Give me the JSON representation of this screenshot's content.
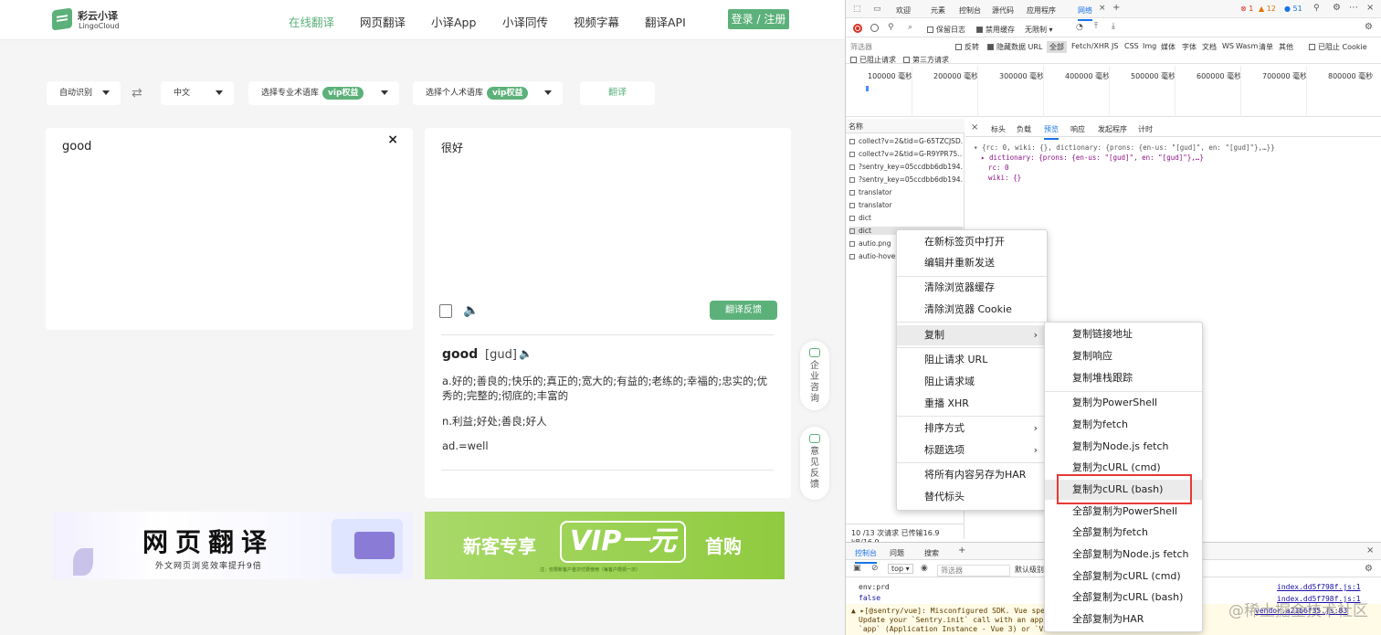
{
  "site": {
    "logo_cn": "彩云小译",
    "logo_en": "LingoCloud",
    "nav": [
      "在线翻译",
      "网页翻译",
      "小译App",
      "小译同传",
      "视频字幕",
      "翻译API"
    ],
    "login": "登录 / 注册"
  },
  "controls": {
    "source_lang": "自动识别",
    "target_lang": "中文",
    "pro_glossary": "选择专业术语库",
    "personal_glossary": "选择个人术语库",
    "vip": "vip权益",
    "translate": "翻译"
  },
  "input": {
    "text": "good"
  },
  "output": {
    "text": "很好",
    "feedback": "翻译反馈",
    "word": "good",
    "phonetic": "[gud]",
    "defs": [
      "a.好的;善良的;快乐的;真正的;宽大的;有益的;老练的;幸福的;忠实的;优秀的;完整的;彻底的;丰富的",
      "n.利益;好处;善良;好人",
      "ad.=well"
    ]
  },
  "side": {
    "consult": "企业咨询",
    "opinion": "意见反馈"
  },
  "banners": {
    "b1_title": "网页翻译",
    "b1_sub": "外文网页浏览效率提升9倍",
    "b2_a": "新客专享",
    "b2_b": "VIP一元",
    "b2_c": "首购",
    "b2_d": "注：仅限新客户首次付费使用（每客户限领一次）"
  },
  "devtools": {
    "tabs": [
      "欢迎",
      "元素",
      "控制台",
      "源代码",
      "应用程序",
      "网络"
    ],
    "badges": {
      "errors": "1",
      "warnings": "12",
      "info": "51"
    },
    "preserve_log": "保留日志",
    "disable_cache": "禁用缓存",
    "throttle": "无限制",
    "filter_placeholder": "筛选器",
    "invert": "反转",
    "hide_data_url": "隐藏数据 URL",
    "all": "全部",
    "types": [
      "Fetch/XHR",
      "JS",
      "CSS",
      "Img",
      "媒体",
      "字体",
      "文档",
      "WS",
      "Wasm",
      "清单",
      "其他"
    ],
    "blocked_cookies": "已阻止 Cookie",
    "blocked_requests": "已阻止请求",
    "third_party": "第三方请求",
    "timeline": [
      "100000 毫秒",
      "200000 毫秒",
      "300000 毫秒",
      "400000 毫秒",
      "500000 毫秒",
      "600000 毫秒",
      "700000 毫秒",
      "800000 毫秒"
    ],
    "name_header": "名称",
    "requests": [
      "collect?v=2&tid=G-65TZCJSD...",
      "collect?v=2&tid=G-R9YPR75...",
      "?sentry_key=05ccdbb6db194...",
      "?sentry_key=05ccdbb6db194...",
      "translator",
      "translator",
      "dict",
      "dict",
      "autio.png",
      "autio-hover..."
    ],
    "detail_tabs": [
      "标头",
      "负载",
      "预览",
      "响应",
      "发起程序",
      "计时"
    ],
    "preview": [
      "▾ {rc: 0, wiki: {}, dictionary: {prons: {en-us: \"[gud]\", en: \"[gud]\"},…}}",
      "▸ dictionary: {prons: {en-us: \"[gud]\", en: \"[gud]\"},…}",
      "rc: 0",
      "wiki: {}"
    ],
    "status": "10 /13 次请求  已传输16.9 kB/16.9",
    "console_tabs": [
      "控制台",
      "问题",
      "搜索"
    ],
    "console_context": "top",
    "console_filter": "筛选器",
    "default_levels": "默认级别",
    "logs": [
      "env:prd",
      "false",
      "▲ ▸[@sentry/vue]: Misconfigured SDK. Vue specif",
      "Update your `Sentry.init` call with an appropr",
      "`app` (Application Instance - Vue 3) or `Vue`"
    ],
    "log_links": [
      "index.dd5f798f.js:1",
      "index.dd5f798f.js:1",
      "vendor.a21b6f35.js:83"
    ]
  },
  "context_menu": {
    "items": [
      "在新标签页中打开",
      "编辑并重新发送",
      "清除浏览器缓存",
      "清除浏览器 Cookie",
      "复制",
      "阻止请求 URL",
      "阻止请求域",
      "重播 XHR",
      "排序方式",
      "标题选项",
      "将所有内容另存为HAR",
      "替代标头"
    ]
  },
  "copy_menu": {
    "items": [
      "复制链接地址",
      "复制响应",
      "复制堆栈跟踪",
      "复制为PowerShell",
      "复制为fetch",
      "复制为Node.js fetch",
      "复制为cURL (cmd)",
      "复制为cURL (bash)",
      "全部复制为PowerShell",
      "全部复制为fetch",
      "全部复制为Node.js fetch",
      "全部复制为cURL (cmd)",
      "全部复制为cURL (bash)",
      "全部复制为HAR"
    ]
  },
  "watermark": "@稀土掘金技术社区"
}
